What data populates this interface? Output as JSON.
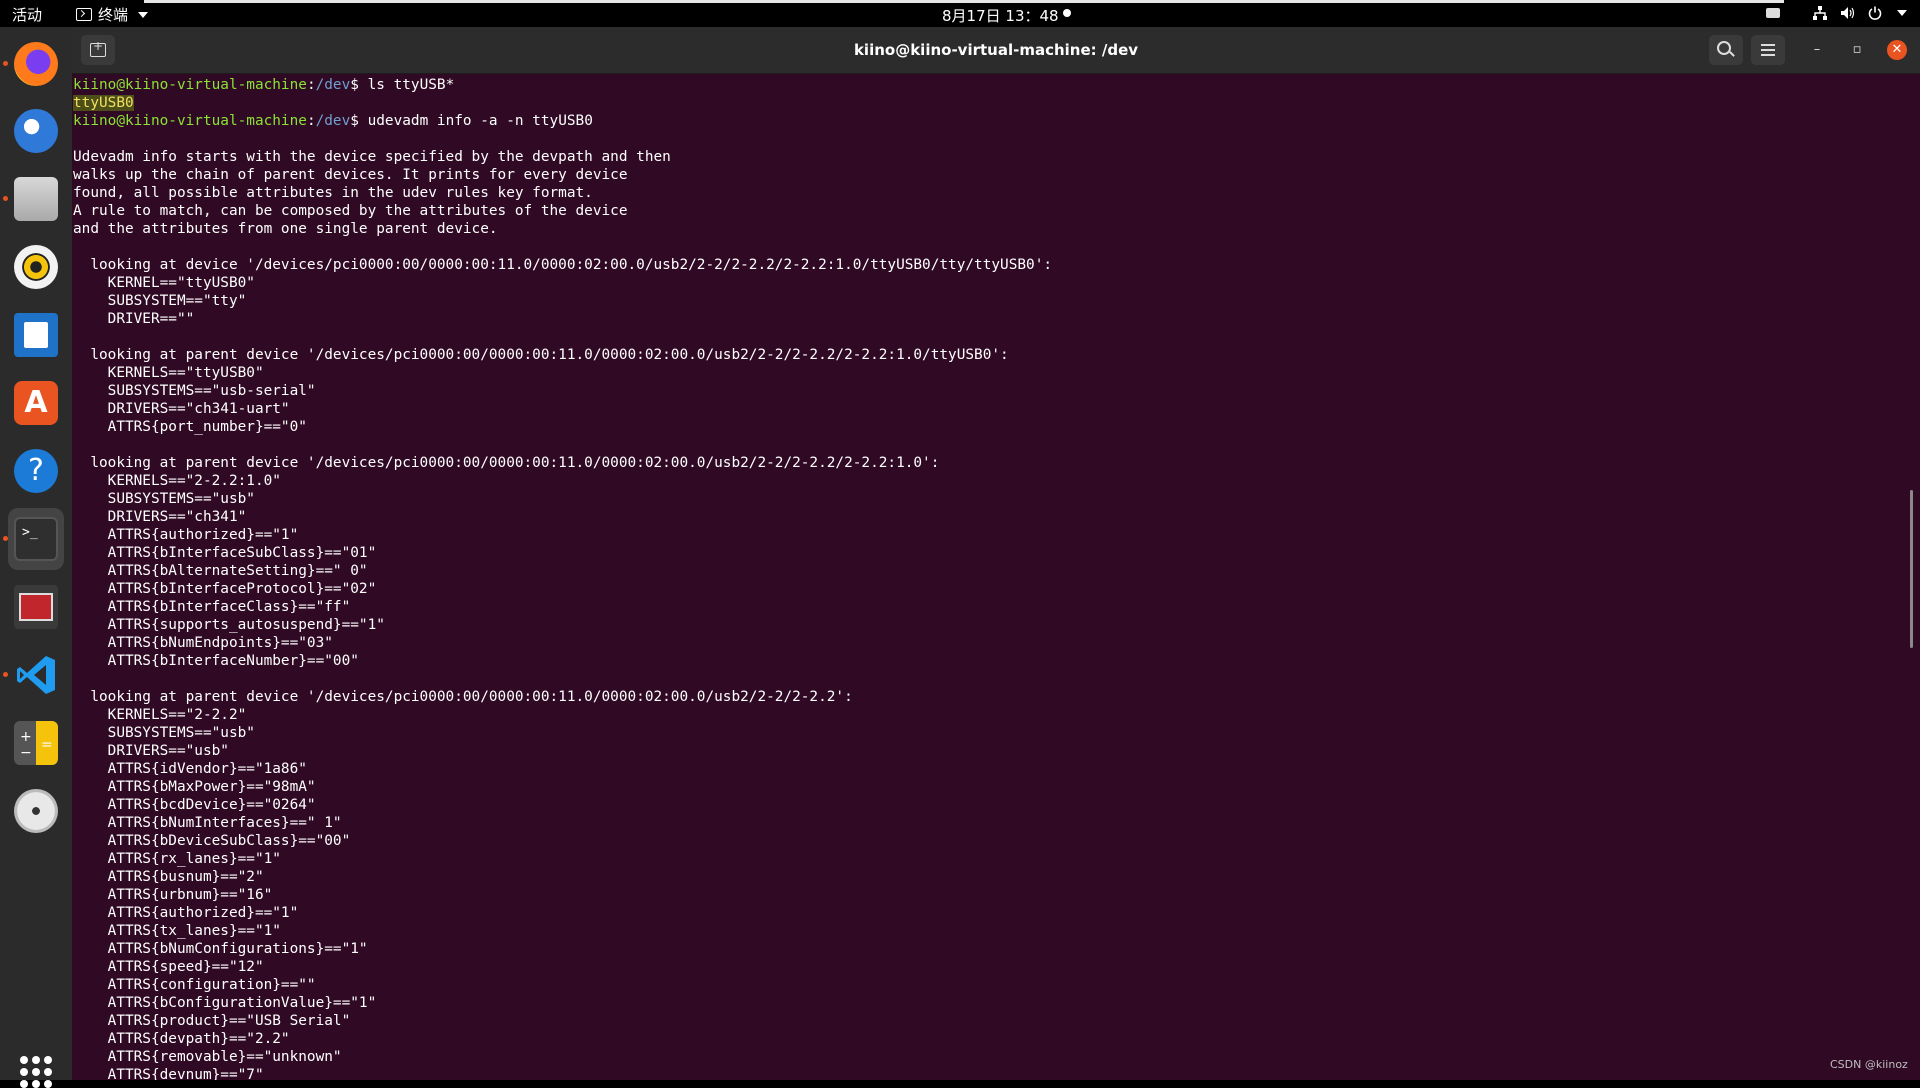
{
  "topbar": {
    "activities": "活动",
    "app_name": "终端",
    "clock": "8月17日 13：48"
  },
  "dock": {
    "items": [
      {
        "name": "firefox",
        "label": "Firefox",
        "running": true
      },
      {
        "name": "thunderbird",
        "label": "Thunderbird",
        "running": false
      },
      {
        "name": "files",
        "label": "Files",
        "running": true
      },
      {
        "name": "rhythmbox",
        "label": "Rhythmbox",
        "running": false
      },
      {
        "name": "libreoffice-writer",
        "label": "LibreOffice Writer",
        "running": false
      },
      {
        "name": "ubuntu-software",
        "label": "Ubuntu Software",
        "running": false
      },
      {
        "name": "help",
        "label": "Help",
        "running": false
      },
      {
        "name": "terminal",
        "label": "Terminal",
        "running": true,
        "active": true
      },
      {
        "name": "serial-tool",
        "label": "Serial Tool",
        "running": false
      },
      {
        "name": "vscode",
        "label": "Visual Studio Code",
        "running": true
      },
      {
        "name": "calculator",
        "label": "Calculator",
        "running": false
      },
      {
        "name": "dvd",
        "label": "DVD",
        "running": false
      }
    ],
    "show_apps": "show-applications"
  },
  "window": {
    "title": "kiino@kiino-virtual-machine: /dev",
    "buttons": {
      "new_tab": "new-tab-icon",
      "search": "search-icon",
      "menu": "hamburger-menu-icon",
      "minimize": "–",
      "maximize": "▫",
      "close": "✕"
    }
  },
  "terminal": {
    "prompt_user": "kiino@kiino-virtual-machine",
    "prompt_sep": ":",
    "prompt_path": "/dev",
    "prompt_dollar": "$",
    "cmd1": " ls ttyUSB*",
    "ls_result": "ttyUSB0",
    "cmd2": " udevadm info -a -n ttyUSB0",
    "lines": [
      "",
      "Udevadm info starts with the device specified by the devpath and then",
      "walks up the chain of parent devices. It prints for every device",
      "found, all possible attributes in the udev rules key format.",
      "A rule to match, can be composed by the attributes of the device",
      "and the attributes from one single parent device.",
      "",
      "  looking at device '/devices/pci0000:00/0000:00:11.0/0000:02:00.0/usb2/2-2/2-2.2/2-2.2:1.0/ttyUSB0/tty/ttyUSB0':",
      "    KERNEL==\"ttyUSB0\"",
      "    SUBSYSTEM==\"tty\"",
      "    DRIVER==\"\"",
      "",
      "  looking at parent device '/devices/pci0000:00/0000:00:11.0/0000:02:00.0/usb2/2-2/2-2.2/2-2.2:1.0/ttyUSB0':",
      "    KERNELS==\"ttyUSB0\"",
      "    SUBSYSTEMS==\"usb-serial\"",
      "    DRIVERS==\"ch341-uart\"",
      "    ATTRS{port_number}==\"0\"",
      "",
      "  looking at parent device '/devices/pci0000:00/0000:00:11.0/0000:02:00.0/usb2/2-2/2-2.2/2-2.2:1.0':",
      "    KERNELS==\"2-2.2:1.0\"",
      "    SUBSYSTEMS==\"usb\"",
      "    DRIVERS==\"ch341\"",
      "    ATTRS{authorized}==\"1\"",
      "    ATTRS{bInterfaceSubClass}==\"01\"",
      "    ATTRS{bAlternateSetting}==\" 0\"",
      "    ATTRS{bInterfaceProtocol}==\"02\"",
      "    ATTRS{bInterfaceClass}==\"ff\"",
      "    ATTRS{supports_autosuspend}==\"1\"",
      "    ATTRS{bNumEndpoints}==\"03\"",
      "    ATTRS{bInterfaceNumber}==\"00\"",
      "",
      "  looking at parent device '/devices/pci0000:00/0000:00:11.0/0000:02:00.0/usb2/2-2/2-2.2':",
      "    KERNELS==\"2-2.2\"",
      "    SUBSYSTEMS==\"usb\"",
      "    DRIVERS==\"usb\"",
      "    ATTRS{idVendor}==\"1a86\"",
      "    ATTRS{bMaxPower}==\"98mA\"",
      "    ATTRS{bcdDevice}==\"0264\"",
      "    ATTRS{bNumInterfaces}==\" 1\"",
      "    ATTRS{bDeviceSubClass}==\"00\"",
      "    ATTRS{rx_lanes}==\"1\"",
      "    ATTRS{busnum}==\"2\"",
      "    ATTRS{urbnum}==\"16\"",
      "    ATTRS{authorized}==\"1\"",
      "    ATTRS{tx_lanes}==\"1\"",
      "    ATTRS{bNumConfigurations}==\"1\"",
      "    ATTRS{speed}==\"12\"",
      "    ATTRS{configuration}==\"\"",
      "    ATTRS{bConfigurationValue}==\"1\"",
      "    ATTRS{product}==\"USB Serial\"",
      "    ATTRS{devpath}==\"2.2\"",
      "    ATTRS{removable}==\"unknown\"",
      "    ATTRS{devnum}==\"7\""
    ]
  },
  "watermark": "CSDN @kiinoz",
  "colors": {
    "terminal_bg": "#300a24",
    "prompt_user": "#8ae234",
    "prompt_path": "#729fcf",
    "accent": "#e95420"
  }
}
